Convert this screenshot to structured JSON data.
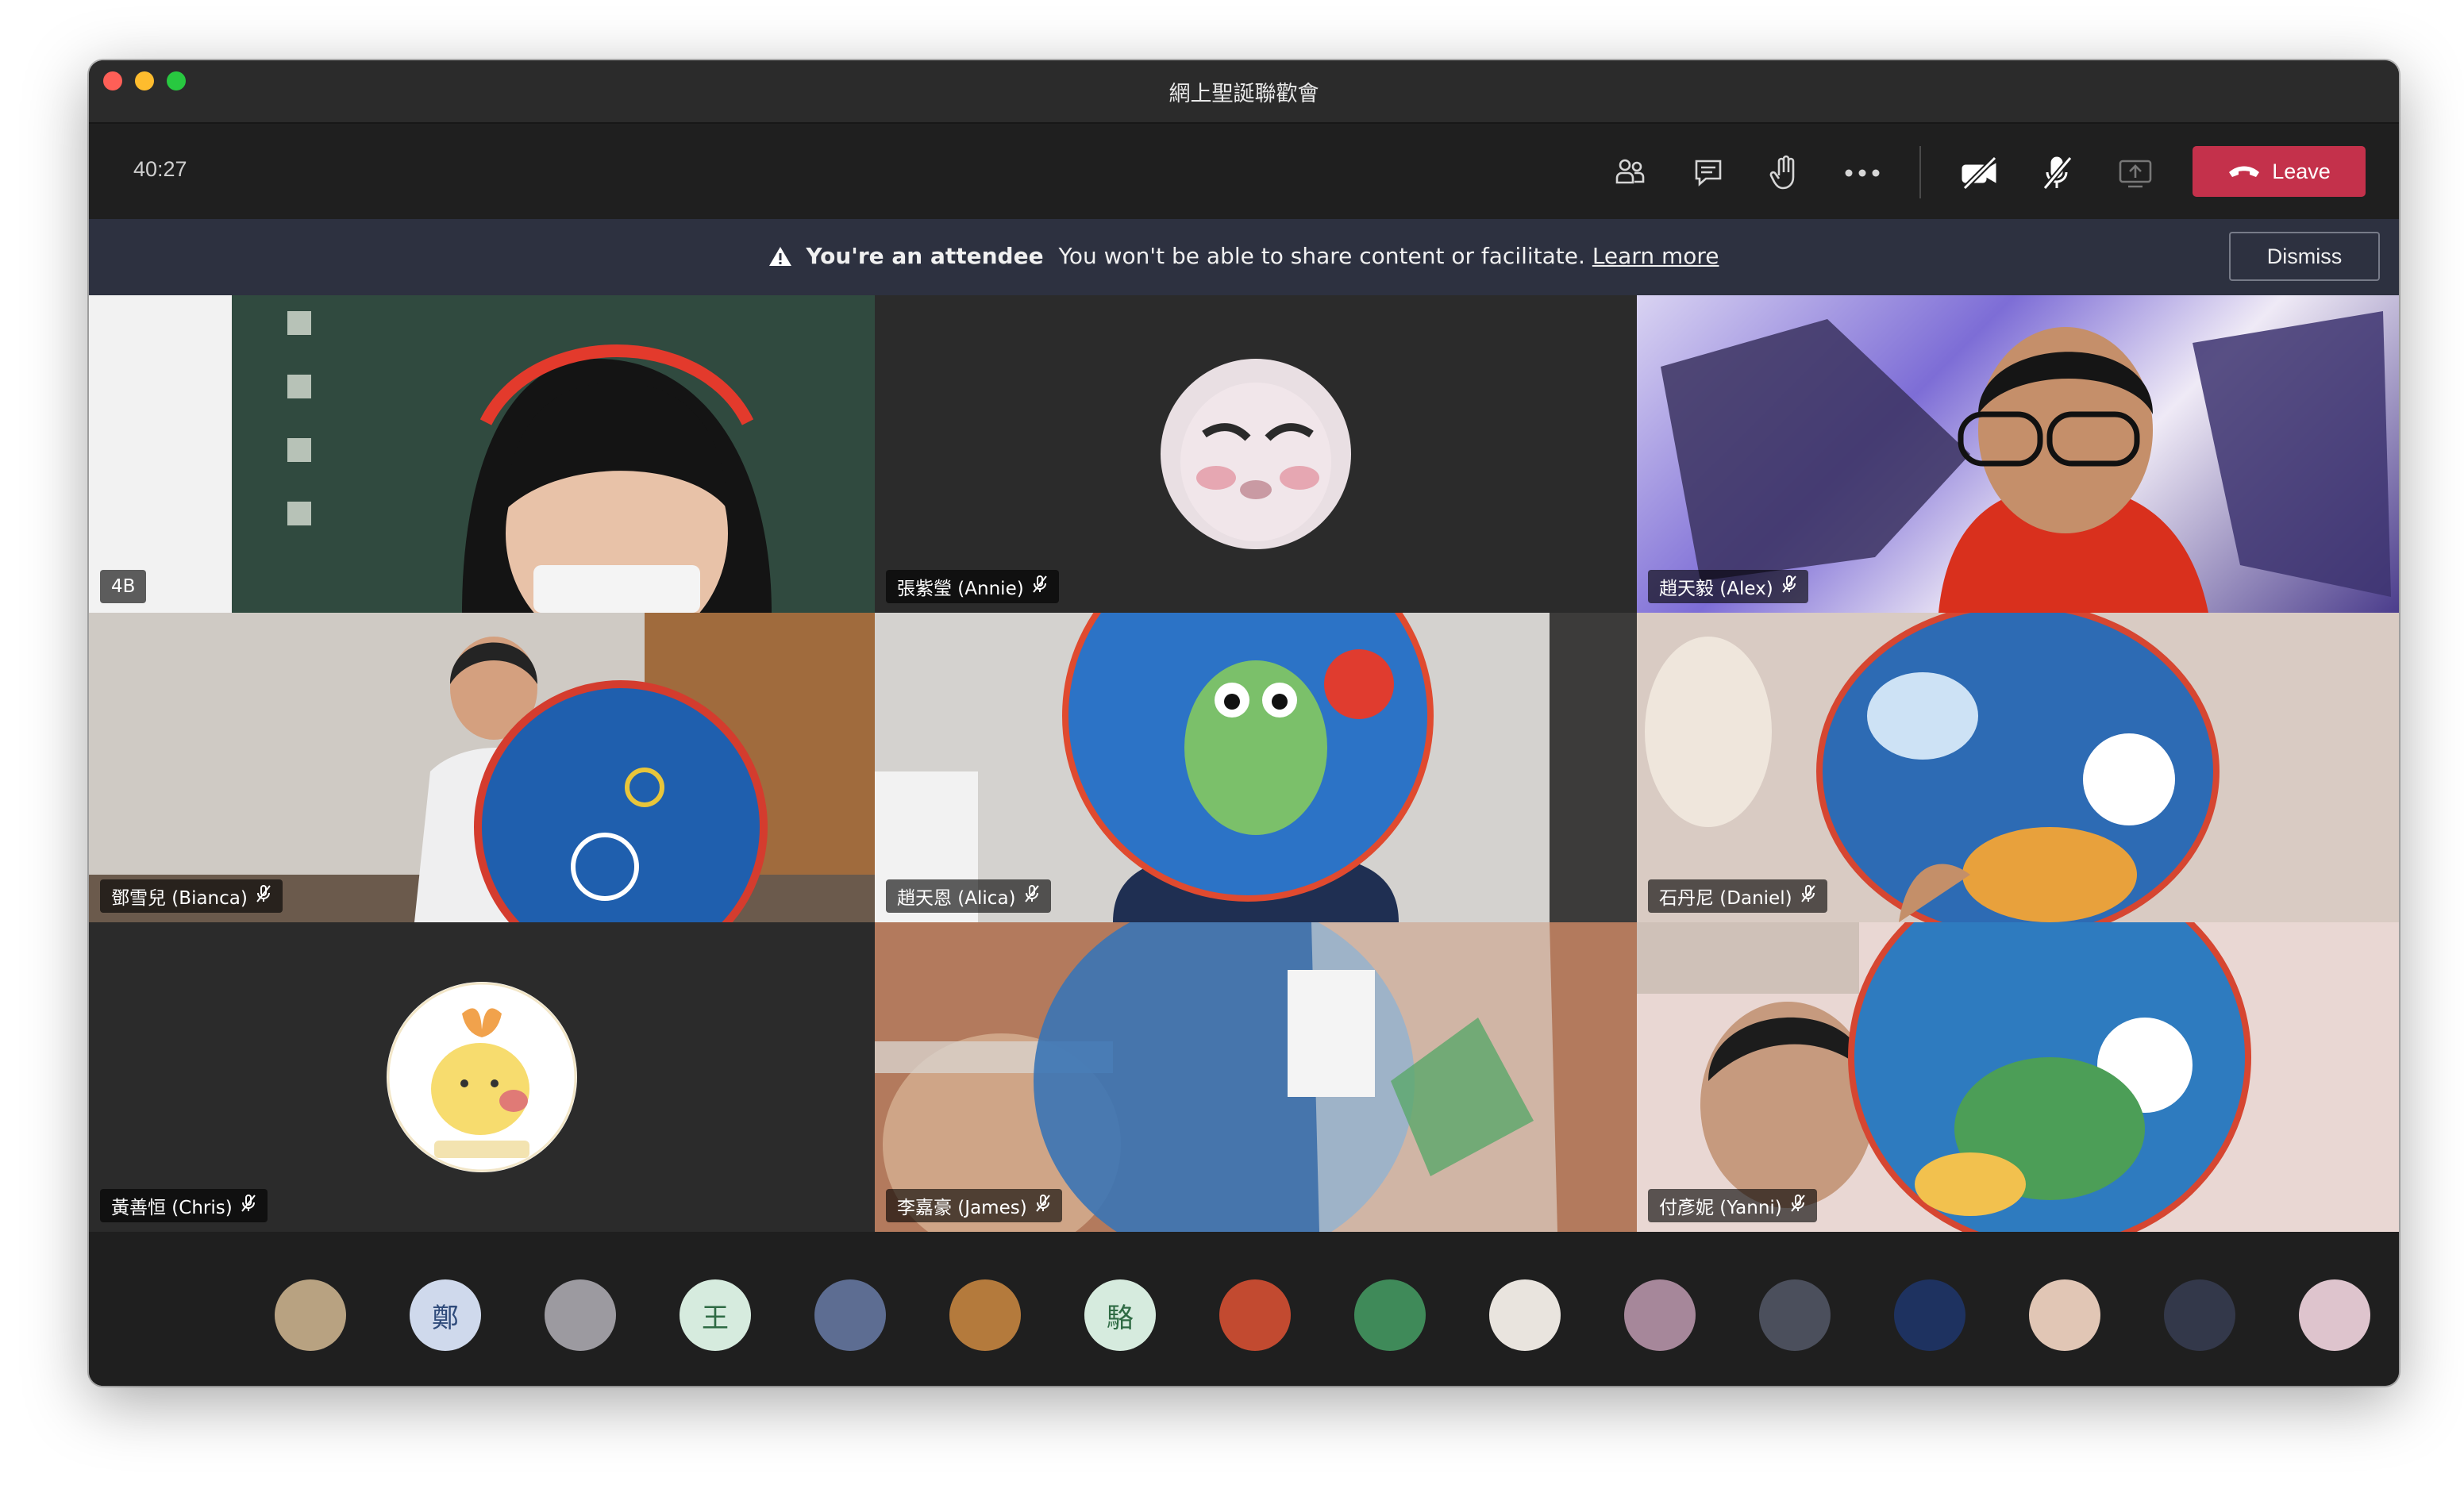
{
  "window": {
    "title": "網上聖誕聯歡會"
  },
  "toolbar": {
    "timer": "40:27",
    "leave_label": "Leave",
    "icons": [
      "participants-icon",
      "chat-icon",
      "raise-hand-icon",
      "more-options-icon",
      "camera-off-icon",
      "mic-off-icon",
      "share-screen-icon",
      "phone-hangup-icon"
    ]
  },
  "banner": {
    "title": "You're an attendee",
    "message": "You won't be able to share content or facilitate.",
    "link": "Learn more",
    "dismiss_label": "Dismiss"
  },
  "grid": {
    "tiles": [
      {
        "name": "4B",
        "type": "video"
      },
      {
        "name": "張紫瑩 (Annie)",
        "type": "avatar"
      },
      {
        "name": "趙天毅 (Alex)",
        "type": "video"
      },
      {
        "name": "鄧雪兒 (Bianca)",
        "type": "video"
      },
      {
        "name": "趙天恩 (Alica)",
        "type": "video"
      },
      {
        "name": "石丹尼 (Daniel)",
        "type": "video"
      },
      {
        "name": "黃善恒 (Chris)",
        "type": "avatar"
      },
      {
        "name": "李嘉豪 (James)",
        "type": "video"
      },
      {
        "name": "付彥妮 (Yanni)",
        "type": "video"
      }
    ]
  },
  "strip": {
    "avatars": [
      {
        "initial": "",
        "color": "#b8a281"
      },
      {
        "initial": "鄭",
        "color": "#cfd9ec"
      },
      {
        "initial": "",
        "color": "#9c9aa0"
      },
      {
        "initial": "王",
        "color": "#d6ebde"
      },
      {
        "initial": "",
        "color": "#5d6d92"
      },
      {
        "initial": "",
        "color": "#b47a3c"
      },
      {
        "initial": "駱",
        "color": "#d6ebde"
      },
      {
        "initial": "",
        "color": "#c24a30"
      },
      {
        "initial": "",
        "color": "#3f8a59"
      },
      {
        "initial": "",
        "color": "#e9e4de"
      },
      {
        "initial": "",
        "color": "#a6879a"
      },
      {
        "initial": "",
        "color": "#4b4f5c"
      },
      {
        "initial": "",
        "color": "#1e3260"
      },
      {
        "initial": "",
        "color": "#e1c6b5"
      },
      {
        "initial": "",
        "color": "#33384a"
      },
      {
        "initial": "",
        "color": "#dec4cd"
      }
    ]
  },
  "colors": {
    "leave": "#c4314b",
    "banner": "#2d3140",
    "background": "#1f1f1f"
  }
}
